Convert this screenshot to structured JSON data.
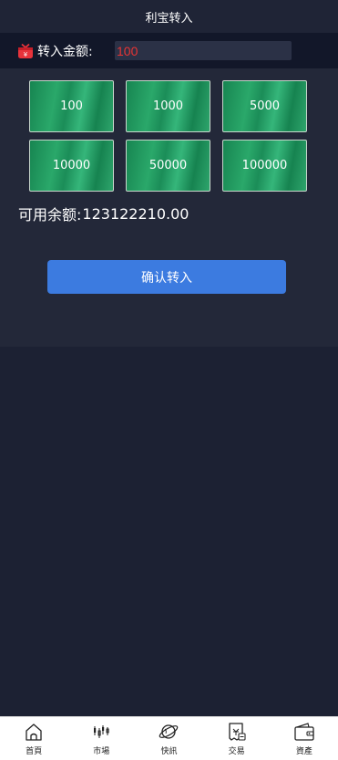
{
  "header": {
    "title": "利宝转入"
  },
  "amount": {
    "label": "转入金额:",
    "value": "100"
  },
  "presets": [
    "100",
    "1000",
    "5000",
    "10000",
    "50000",
    "100000"
  ],
  "balance": {
    "label": "可用余额:",
    "value": "123122210.00"
  },
  "confirm_label": "确认转入",
  "tabs": [
    {
      "label": "首頁",
      "icon": "home-icon"
    },
    {
      "label": "市場",
      "icon": "candlestick-icon"
    },
    {
      "label": "快訊",
      "icon": "planet-icon"
    },
    {
      "label": "交易",
      "icon": "trade-receipt-icon"
    },
    {
      "label": "資產",
      "icon": "wallet-icon"
    }
  ],
  "colors": {
    "background": "#1c2133",
    "amount_text": "#e83434",
    "preset_green": "#1f9a60",
    "confirm_blue": "#3c7be0",
    "icon_red": "#e8333b"
  }
}
